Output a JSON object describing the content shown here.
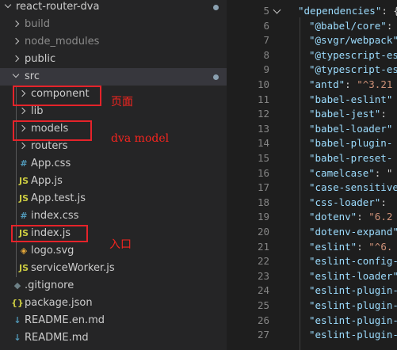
{
  "explorer": {
    "root": "react-router-dva",
    "items": [
      {
        "label": "build",
        "kind": "folder",
        "level": 1,
        "open": false,
        "color": "#8b8b8b"
      },
      {
        "label": "node_modules",
        "kind": "folder",
        "level": 1,
        "open": false,
        "color": "#8b8b8b"
      },
      {
        "label": "public",
        "kind": "folder",
        "level": 1,
        "open": false
      },
      {
        "label": "src",
        "kind": "folder",
        "level": 1,
        "open": true,
        "selected": true
      },
      {
        "label": "component",
        "kind": "folder",
        "level": 2,
        "open": false
      },
      {
        "label": "lib",
        "kind": "folder",
        "level": 2,
        "open": false
      },
      {
        "label": "models",
        "kind": "folder",
        "level": 2,
        "open": false
      },
      {
        "label": "routers",
        "kind": "folder",
        "level": 2,
        "open": false
      },
      {
        "label": "App.css",
        "kind": "file",
        "level": 2,
        "icon": "#",
        "iconColor": "#519aba"
      },
      {
        "label": "App.js",
        "kind": "file",
        "level": 2,
        "icon": "JS",
        "iconColor": "#cbcb41"
      },
      {
        "label": "App.test.js",
        "kind": "file",
        "level": 2,
        "icon": "JS",
        "iconColor": "#cbcb41"
      },
      {
        "label": "index.css",
        "kind": "file",
        "level": 2,
        "icon": "#",
        "iconColor": "#519aba"
      },
      {
        "label": "index.js",
        "kind": "file",
        "level": 2,
        "icon": "JS",
        "iconColor": "#cbcb41"
      },
      {
        "label": "logo.svg",
        "kind": "file",
        "level": 2,
        "icon": "◈",
        "iconColor": "#e7a93a"
      },
      {
        "label": "serviceWorker.js",
        "kind": "file",
        "level": 2,
        "icon": "JS",
        "iconColor": "#cbcb41"
      },
      {
        "label": ".gitignore",
        "kind": "file",
        "level": 1,
        "icon": "◆",
        "iconColor": "#6d8086"
      },
      {
        "label": "package.json",
        "kind": "file",
        "level": 1,
        "icon": "{}",
        "iconColor": "#cbcb41"
      },
      {
        "label": "README.en.md",
        "kind": "file",
        "level": 1,
        "icon": "↓",
        "iconColor": "#519aba"
      },
      {
        "label": "README.md",
        "kind": "file",
        "level": 1,
        "icon": "↓",
        "iconColor": "#519aba"
      }
    ]
  },
  "annotations": {
    "component": "页面",
    "models": "dva model",
    "index": "入口"
  },
  "editor": {
    "lines": [
      {
        "n": "5",
        "key": "\"dependencies\"",
        "rest": ": {",
        "fold": true
      },
      {
        "n": "6",
        "key": "\"@babel/core\"",
        "rest": ":"
      },
      {
        "n": "7",
        "key": "\"@svgr/webpack\"",
        "rest": ""
      },
      {
        "n": "8",
        "key": "\"@typescript-es",
        "rest": ""
      },
      {
        "n": "9",
        "key": "\"@typescript-es",
        "rest": ""
      },
      {
        "n": "10",
        "key": "\"antd\"",
        "rest": ": ",
        "str": "\"^3.21"
      },
      {
        "n": "11",
        "key": "\"babel-eslint\"",
        "rest": ""
      },
      {
        "n": "12",
        "key": "\"babel-jest\"",
        "rest": ": "
      },
      {
        "n": "13",
        "key": "\"babel-loader\"",
        "rest": ""
      },
      {
        "n": "14",
        "key": "\"babel-plugin-",
        "rest": ""
      },
      {
        "n": "15",
        "key": "\"babel-preset-",
        "rest": ""
      },
      {
        "n": "16",
        "key": "\"camelcase\"",
        "rest": ": \""
      },
      {
        "n": "17",
        "key": "\"case-sensitive",
        "rest": ""
      },
      {
        "n": "18",
        "key": "\"css-loader\"",
        "rest": ": "
      },
      {
        "n": "19",
        "key": "\"dotenv\"",
        "rest": ": ",
        "str": "\"6.2"
      },
      {
        "n": "20",
        "key": "\"dotenv-expand\"",
        "rest": ""
      },
      {
        "n": "21",
        "key": "\"eslint\"",
        "rest": ": ",
        "str": "\"^6."
      },
      {
        "n": "22",
        "key": "\"eslint-config-",
        "rest": ""
      },
      {
        "n": "23",
        "key": "\"eslint-loader\"",
        "rest": ""
      },
      {
        "n": "24",
        "key": "\"eslint-plugin-",
        "rest": ""
      },
      {
        "n": "25",
        "key": "\"eslint-plugin-",
        "rest": ""
      },
      {
        "n": "26",
        "key": "\"eslint-plugin-",
        "rest": ""
      },
      {
        "n": "27",
        "key": "\"eslint-plugin-",
        "rest": ""
      }
    ]
  }
}
